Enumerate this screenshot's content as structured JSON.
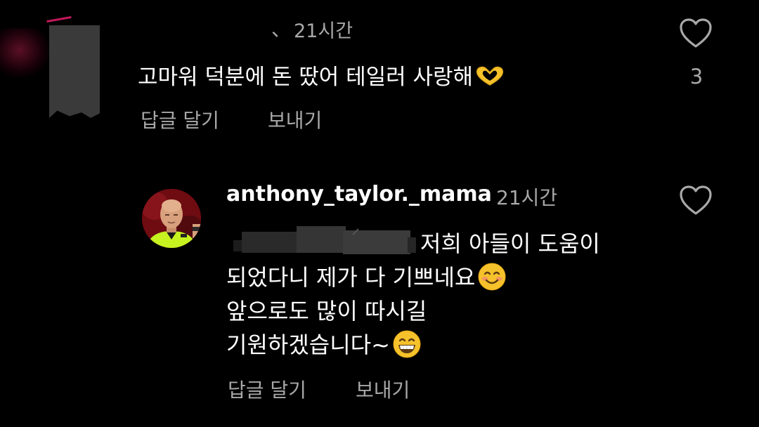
{
  "comments": [
    {
      "author_fragment": "、",
      "time": "21시간",
      "text": "고마워 덕분에 돈 땄어 테일러 사랑해",
      "text_emoji": "heart-hands-emoji",
      "actions": {
        "reply": "답글 달기",
        "send": "보내기"
      },
      "like_count": "3",
      "avatar_censored": true
    },
    {
      "author": "anthony_taylor._mama",
      "time": "21시간",
      "mention_censored": true,
      "lines": [
        "저희 아들이 도움이",
        "되었다니 제가 다 기쁘네요",
        "앞으로도 많이 따시길",
        "기원하겠습니다~"
      ],
      "line_emojis": [
        "",
        "smiling-face-emoji",
        "",
        "grinning-face-emoji"
      ],
      "actions": {
        "reply": "답글 달기",
        "send": "보내기"
      }
    }
  ],
  "colors": {
    "background": "#000000",
    "primary_text": "#ffffff",
    "secondary_text": "#a8a8a8",
    "emoji_yellow": "#f6c22b"
  }
}
